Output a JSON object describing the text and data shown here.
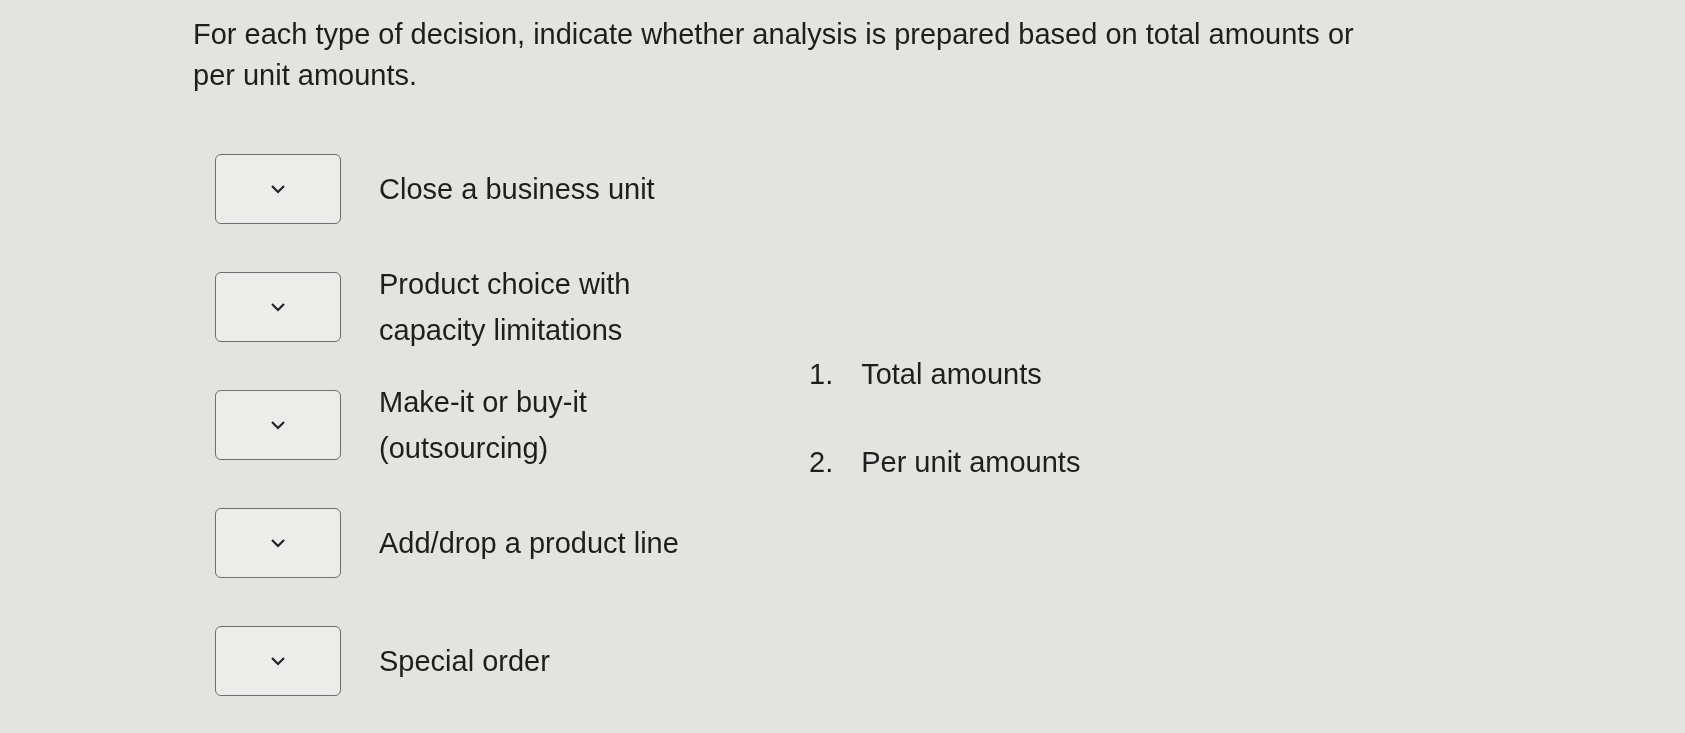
{
  "question": "For each type of decision, indicate whether analysis is prepared based on total amounts or per unit amounts.",
  "items": [
    {
      "label": "Close a business unit"
    },
    {
      "label": "Product choice with capacity limitations"
    },
    {
      "label": "Make-it or buy-it (outsourcing)"
    },
    {
      "label": "Add/drop a product line"
    },
    {
      "label": "Special order"
    }
  ],
  "options": [
    {
      "number": "1.",
      "text": "Total amounts"
    },
    {
      "number": "2.",
      "text": "Per unit amounts"
    }
  ]
}
